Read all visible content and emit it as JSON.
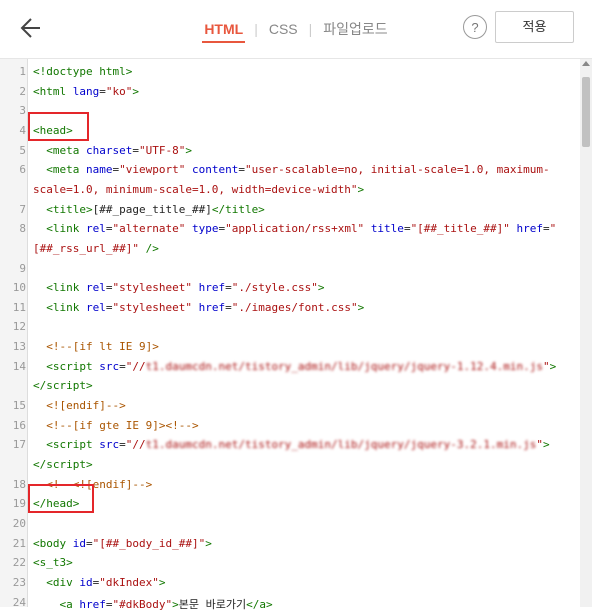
{
  "tabs": [
    {
      "label": "HTML",
      "active": true
    },
    {
      "label": "CSS",
      "active": false
    },
    {
      "label": "파일업로드",
      "active": false
    }
  ],
  "help_label": "?",
  "apply_label": "적용",
  "lines": [
    {
      "n": "1",
      "html": "<span class=\"t\">&lt;!doctype html&gt;</span>"
    },
    {
      "n": "2",
      "html": "<span class=\"t\">&lt;html</span> <span class=\"a\">lang</span>=<span class=\"s\">\"ko\"</span><span class=\"t\">&gt;</span>"
    },
    {
      "n": "3",
      "html": ""
    },
    {
      "n": "4",
      "html": "<span class=\"t\">&lt;head&gt;</span>"
    },
    {
      "n": "5",
      "html": "  <span class=\"t\">&lt;meta</span> <span class=\"a\">charset</span>=<span class=\"s\">\"UTF-8\"</span><span class=\"t\">&gt;</span>"
    },
    {
      "n": "6",
      "html": "  <span class=\"t\">&lt;meta</span> <span class=\"a\">name</span>=<span class=\"s\">\"viewport\"</span> <span class=\"a\">content</span>=<span class=\"s\">\"user-scalable=no, initial-scale=1.0, maximum-</span>"
    },
    {
      "n": "",
      "html": "<span class=\"s\">scale=1.0, minimum-scale=1.0, width=device-width\"</span><span class=\"t\">&gt;</span>"
    },
    {
      "n": "7",
      "html": "  <span class=\"t\">&lt;title&gt;</span>[##_page_title_##]<span class=\"t\">&lt;/title&gt;</span>"
    },
    {
      "n": "8",
      "html": "  <span class=\"t\">&lt;link</span> <span class=\"a\">rel</span>=<span class=\"s\">\"alternate\"</span> <span class=\"a\">type</span>=<span class=\"s\">\"application/rss+xml\"</span> <span class=\"a\">title</span>=<span class=\"s\">\"[##_title_##]\"</span> <span class=\"a\">href</span>=<span class=\"s\">\"</span>"
    },
    {
      "n": "",
      "html": "<span class=\"s\">[##_rss_url_##]\"</span> <span class=\"t\">/&gt;</span>"
    },
    {
      "n": "9",
      "html": ""
    },
    {
      "n": "10",
      "html": "  <span class=\"t\">&lt;link</span> <span class=\"a\">rel</span>=<span class=\"s\">\"stylesheet\"</span> <span class=\"a\">href</span>=<span class=\"s\">\"./style.css\"</span><span class=\"t\">&gt;</span>"
    },
    {
      "n": "11",
      "html": "  <span class=\"t\">&lt;link</span> <span class=\"a\">rel</span>=<span class=\"s\">\"stylesheet\"</span> <span class=\"a\">href</span>=<span class=\"s\">\"./images/font.css\"</span><span class=\"t\">&gt;</span>"
    },
    {
      "n": "12",
      "html": ""
    },
    {
      "n": "13",
      "html": "  <span class=\"c\">&lt;!--[if lt IE 9]&gt;</span>"
    },
    {
      "n": "14",
      "html": "  <span class=\"t\">&lt;script</span> <span class=\"a\">src</span>=<span class=\"s\">\"//</span><span class=\"blur\">t1.daumcdn.net/tistory_admin/lib/jquery/jquery-1.12.4.min.js</span><span class=\"s\">\"</span><span class=\"t\">&gt;</span>"
    },
    {
      "n": "",
      "html": "<span class=\"t\">&lt;/script&gt;</span>"
    },
    {
      "n": "15",
      "html": "  <span class=\"c\">&lt;![endif]--&gt;</span>"
    },
    {
      "n": "16",
      "html": "  <span class=\"c\">&lt;!--[if gte IE 9]&gt;&lt;!--&gt;</span>"
    },
    {
      "n": "17",
      "html": "  <span class=\"t\">&lt;script</span> <span class=\"a\">src</span>=<span class=\"s\">\"//</span><span class=\"blur\">t1.daumcdn.net/tistory_admin/lib/jquery/jquery-3.2.1.min.js</span><span class=\"s\">\"</span><span class=\"t\">&gt;</span>"
    },
    {
      "n": "",
      "html": "<span class=\"t\">&lt;/script&gt;</span>"
    },
    {
      "n": "18",
      "html": "  <span class=\"c\">&lt;!--&lt;![endif]--&gt;</span>"
    },
    {
      "n": "19",
      "html": "<span class=\"t\">&lt;/head&gt;</span>"
    },
    {
      "n": "20",
      "html": ""
    },
    {
      "n": "21",
      "html": "<span class=\"t\">&lt;body</span> <span class=\"a\">id</span>=<span class=\"s\">\"[##_body_id_##]\"</span><span class=\"t\">&gt;</span>"
    },
    {
      "n": "22",
      "html": "<span class=\"t\">&lt;s_t3&gt;</span>"
    },
    {
      "n": "23",
      "html": "  <span class=\"t\">&lt;div</span> <span class=\"a\">id</span>=<span class=\"s\">\"dkIndex\"</span><span class=\"t\">&gt;</span>"
    },
    {
      "n": "24",
      "html": "    <span class=\"t\">&lt;a</span> <span class=\"a\">href</span>=<span class=\"s\">\"#dkBody\"</span><span class=\"t\">&gt;</span>본문 바로가기<span class=\"t\">&lt;/a&gt;</span>"
    }
  ]
}
